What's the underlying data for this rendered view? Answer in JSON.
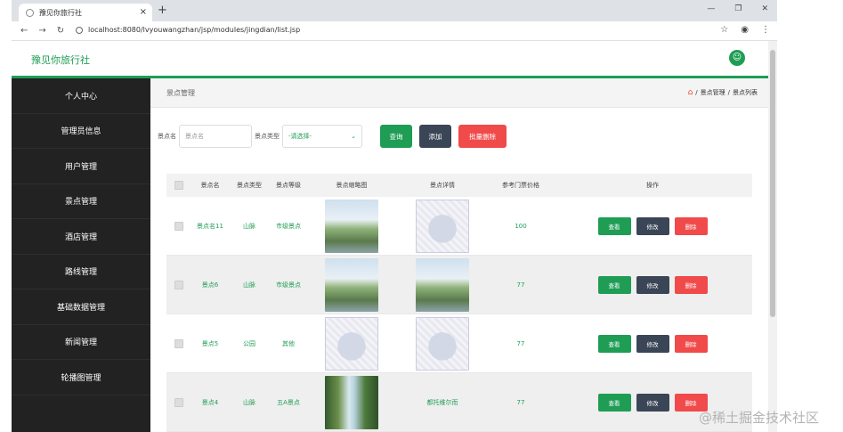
{
  "browser": {
    "tab_title": "豫见你旅行社",
    "tab_close": "×",
    "new_tab": "+",
    "url": "localhost:8080/lvyouwangzhan/jsp/modules/jingdian/list.jsp"
  },
  "header": {
    "brand": "豫见你旅行社"
  },
  "sidebar": {
    "items": [
      "个人中心",
      "管理员信息",
      "用户管理",
      "景点管理",
      "酒店管理",
      "路线管理",
      "基础数据管理",
      "新闻管理",
      "轮播图管理"
    ]
  },
  "main": {
    "page_title": "景点管理",
    "breadcrumb": [
      "景点管理",
      "景点列表"
    ],
    "breadcrumb_sep": "/",
    "search": {
      "name_label": "景点名",
      "name_placeholder": "景点名",
      "type_label": "景点类型",
      "type_selected": "-请选择-",
      "query_label": "查询",
      "add_label": "添加",
      "batch_delete_label": "批量删除"
    },
    "table": {
      "headers": [
        "景点名",
        "景点类型",
        "景点等级",
        "景点缩略图",
        "景点详情",
        "参考门票价格",
        "操作"
      ],
      "rows": [
        {
          "name": "景点名11",
          "type": "山脉",
          "level": "市级景点",
          "thumb": "landscape",
          "detail": "map",
          "price": "100"
        },
        {
          "name": "景点6",
          "type": "山脉",
          "level": "市级景点",
          "thumb": "landscape",
          "detail": "landscape",
          "price": "77"
        },
        {
          "name": "景点5",
          "type": "公园",
          "level": "其他",
          "thumb": "map",
          "detail": "map",
          "price": "77"
        },
        {
          "name": "景点4",
          "type": "山脉",
          "level": "五A景点",
          "thumb": "waterfall",
          "detail_text": "都托维尔而",
          "price": "77"
        }
      ],
      "ops": {
        "view": "查看",
        "edit": "修改",
        "delete": "删除"
      }
    }
  },
  "watermark": "@稀土掘金技术社区",
  "colors": {
    "accent": "#1f9d55",
    "sidebar": "#222222",
    "danger": "#f04a4a",
    "dark_button": "#3a4556"
  }
}
